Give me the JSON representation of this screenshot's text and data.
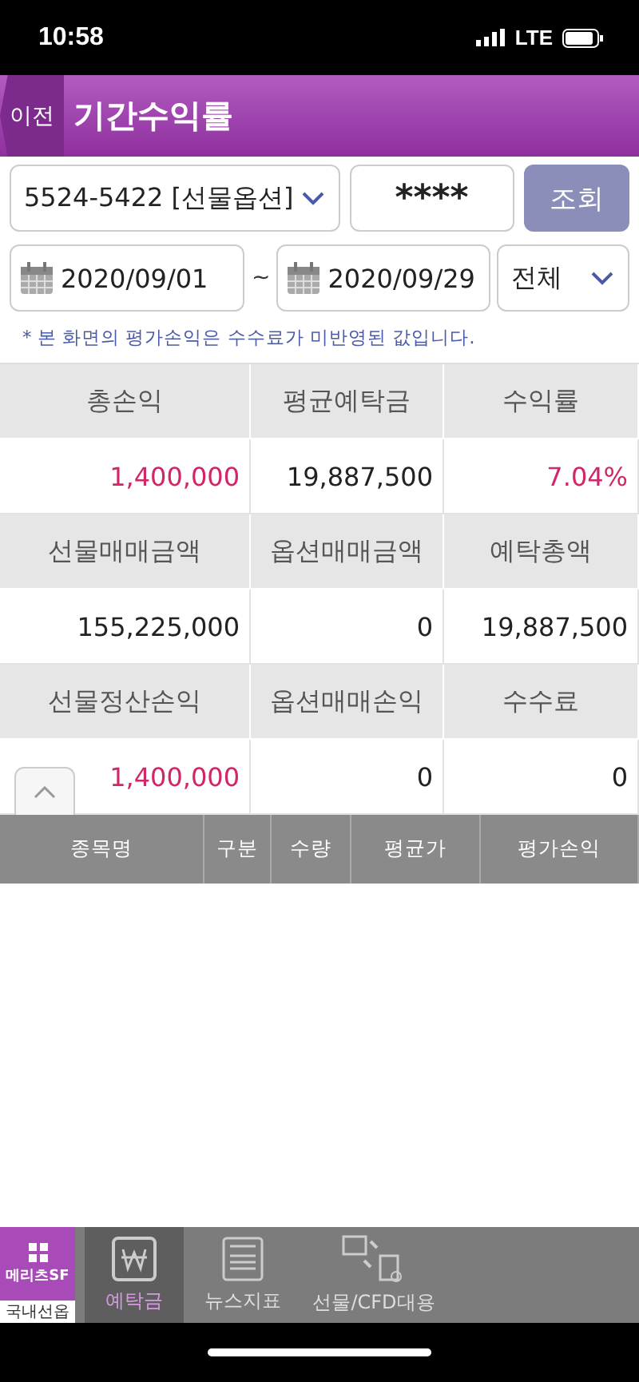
{
  "status_bar": {
    "time": "10:58",
    "network": "LTE"
  },
  "header": {
    "back": "이전",
    "title": "기간수익률"
  },
  "account": {
    "value": "5524-5422 [선물옵션]",
    "password": "****",
    "search_button": "조회"
  },
  "period": {
    "from": "2020/09/01",
    "separator": "~",
    "to": "2020/09/29",
    "filter": "전체"
  },
  "note": "* 본 화면의 평가손익은 수수료가 미반영된 값입니다.",
  "summary": [
    {
      "labels": [
        "총손익",
        "평균예탁금",
        "수익률"
      ],
      "values": [
        {
          "text": "1,400,000",
          "color": "#d1266a"
        },
        {
          "text": "19,887,500",
          "color": "#222222"
        },
        {
          "text": "7.04%",
          "color": "#d1266a"
        }
      ]
    },
    {
      "labels": [
        "선물매매금액",
        "옵션매매금액",
        "예탁총액"
      ],
      "values": [
        {
          "text": "155,225,000",
          "color": "#222222"
        },
        {
          "text": "0",
          "color": "#222222"
        },
        {
          "text": "19,887,500",
          "color": "#222222"
        }
      ]
    },
    {
      "labels": [
        "선물정산손익",
        "옵션매매손익",
        "수수료"
      ],
      "values": [
        {
          "text": "1,400,000",
          "color": "#d1266a"
        },
        {
          "text": "0",
          "color": "#222222"
        },
        {
          "text": "0",
          "color": "#222222"
        }
      ]
    }
  ],
  "columns": [
    "종목명",
    "구분",
    "수량",
    "평균가",
    "평가손익"
  ],
  "bottom_bar": {
    "brand": "메리츠SF",
    "brand_label": "국내선옵",
    "tabs": [
      {
        "label": "예탁금",
        "kind": "won",
        "selected": true
      },
      {
        "label": "뉴스지표",
        "kind": "news",
        "selected": false
      },
      {
        "label": "선물/CFD대용",
        "kind": "transfer",
        "selected": false
      }
    ]
  }
}
